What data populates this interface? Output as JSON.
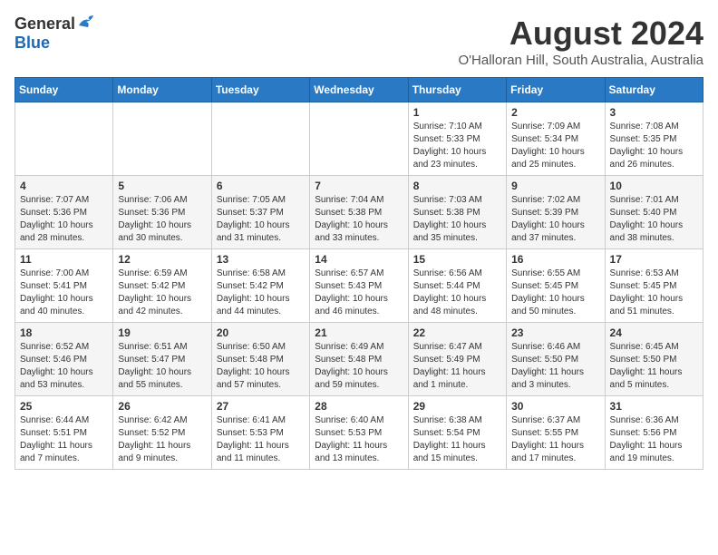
{
  "header": {
    "logo_general": "General",
    "logo_blue": "Blue",
    "main_title": "August 2024",
    "subtitle": "O'Halloran Hill, South Australia, Australia"
  },
  "days_of_week": [
    "Sunday",
    "Monday",
    "Tuesday",
    "Wednesday",
    "Thursday",
    "Friday",
    "Saturday"
  ],
  "weeks": [
    [
      {
        "day": "",
        "info": ""
      },
      {
        "day": "",
        "info": ""
      },
      {
        "day": "",
        "info": ""
      },
      {
        "day": "",
        "info": ""
      },
      {
        "day": "1",
        "info": "Sunrise: 7:10 AM\nSunset: 5:33 PM\nDaylight: 10 hours\nand 23 minutes."
      },
      {
        "day": "2",
        "info": "Sunrise: 7:09 AM\nSunset: 5:34 PM\nDaylight: 10 hours\nand 25 minutes."
      },
      {
        "day": "3",
        "info": "Sunrise: 7:08 AM\nSunset: 5:35 PM\nDaylight: 10 hours\nand 26 minutes."
      }
    ],
    [
      {
        "day": "4",
        "info": "Sunrise: 7:07 AM\nSunset: 5:36 PM\nDaylight: 10 hours\nand 28 minutes."
      },
      {
        "day": "5",
        "info": "Sunrise: 7:06 AM\nSunset: 5:36 PM\nDaylight: 10 hours\nand 30 minutes."
      },
      {
        "day": "6",
        "info": "Sunrise: 7:05 AM\nSunset: 5:37 PM\nDaylight: 10 hours\nand 31 minutes."
      },
      {
        "day": "7",
        "info": "Sunrise: 7:04 AM\nSunset: 5:38 PM\nDaylight: 10 hours\nand 33 minutes."
      },
      {
        "day": "8",
        "info": "Sunrise: 7:03 AM\nSunset: 5:38 PM\nDaylight: 10 hours\nand 35 minutes."
      },
      {
        "day": "9",
        "info": "Sunrise: 7:02 AM\nSunset: 5:39 PM\nDaylight: 10 hours\nand 37 minutes."
      },
      {
        "day": "10",
        "info": "Sunrise: 7:01 AM\nSunset: 5:40 PM\nDaylight: 10 hours\nand 38 minutes."
      }
    ],
    [
      {
        "day": "11",
        "info": "Sunrise: 7:00 AM\nSunset: 5:41 PM\nDaylight: 10 hours\nand 40 minutes."
      },
      {
        "day": "12",
        "info": "Sunrise: 6:59 AM\nSunset: 5:42 PM\nDaylight: 10 hours\nand 42 minutes."
      },
      {
        "day": "13",
        "info": "Sunrise: 6:58 AM\nSunset: 5:42 PM\nDaylight: 10 hours\nand 44 minutes."
      },
      {
        "day": "14",
        "info": "Sunrise: 6:57 AM\nSunset: 5:43 PM\nDaylight: 10 hours\nand 46 minutes."
      },
      {
        "day": "15",
        "info": "Sunrise: 6:56 AM\nSunset: 5:44 PM\nDaylight: 10 hours\nand 48 minutes."
      },
      {
        "day": "16",
        "info": "Sunrise: 6:55 AM\nSunset: 5:45 PM\nDaylight: 10 hours\nand 50 minutes."
      },
      {
        "day": "17",
        "info": "Sunrise: 6:53 AM\nSunset: 5:45 PM\nDaylight: 10 hours\nand 51 minutes."
      }
    ],
    [
      {
        "day": "18",
        "info": "Sunrise: 6:52 AM\nSunset: 5:46 PM\nDaylight: 10 hours\nand 53 minutes."
      },
      {
        "day": "19",
        "info": "Sunrise: 6:51 AM\nSunset: 5:47 PM\nDaylight: 10 hours\nand 55 minutes."
      },
      {
        "day": "20",
        "info": "Sunrise: 6:50 AM\nSunset: 5:48 PM\nDaylight: 10 hours\nand 57 minutes."
      },
      {
        "day": "21",
        "info": "Sunrise: 6:49 AM\nSunset: 5:48 PM\nDaylight: 10 hours\nand 59 minutes."
      },
      {
        "day": "22",
        "info": "Sunrise: 6:47 AM\nSunset: 5:49 PM\nDaylight: 11 hours\nand 1 minute."
      },
      {
        "day": "23",
        "info": "Sunrise: 6:46 AM\nSunset: 5:50 PM\nDaylight: 11 hours\nand 3 minutes."
      },
      {
        "day": "24",
        "info": "Sunrise: 6:45 AM\nSunset: 5:50 PM\nDaylight: 11 hours\nand 5 minutes."
      }
    ],
    [
      {
        "day": "25",
        "info": "Sunrise: 6:44 AM\nSunset: 5:51 PM\nDaylight: 11 hours\nand 7 minutes."
      },
      {
        "day": "26",
        "info": "Sunrise: 6:42 AM\nSunset: 5:52 PM\nDaylight: 11 hours\nand 9 minutes."
      },
      {
        "day": "27",
        "info": "Sunrise: 6:41 AM\nSunset: 5:53 PM\nDaylight: 11 hours\nand 11 minutes."
      },
      {
        "day": "28",
        "info": "Sunrise: 6:40 AM\nSunset: 5:53 PM\nDaylight: 11 hours\nand 13 minutes."
      },
      {
        "day": "29",
        "info": "Sunrise: 6:38 AM\nSunset: 5:54 PM\nDaylight: 11 hours\nand 15 minutes."
      },
      {
        "day": "30",
        "info": "Sunrise: 6:37 AM\nSunset: 5:55 PM\nDaylight: 11 hours\nand 17 minutes."
      },
      {
        "day": "31",
        "info": "Sunrise: 6:36 AM\nSunset: 5:56 PM\nDaylight: 11 hours\nand 19 minutes."
      }
    ]
  ]
}
